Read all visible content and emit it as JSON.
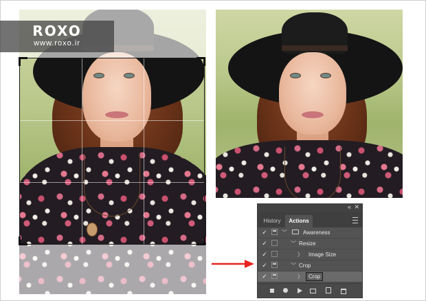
{
  "watermark": {
    "logo": "ROXO",
    "url": "www.roxo.ir"
  },
  "colors": {
    "arrow": "#e8231f",
    "panel_bg": "#535353",
    "panel_tab_bar": "#3f3f3f",
    "selected_row": "#6a6a6a"
  },
  "left_image": {
    "description_role": "photo-with-crop-overlay"
  },
  "right_image": {
    "description_role": "cropped-photo-result"
  },
  "actions_panel": {
    "top_controls": {
      "collapse": "«",
      "close": "✕"
    },
    "tabs": [
      {
        "label": "History",
        "active": false
      },
      {
        "label": "Actions",
        "active": true
      }
    ],
    "rows": [
      {
        "check": "✓",
        "dialog": true,
        "twisty": "﹀",
        "label": "Awareness",
        "kind": "set",
        "selected": false
      },
      {
        "check": "✓",
        "dialog": false,
        "twisty": "﹀",
        "label": "Resize",
        "kind": "action",
        "selected": false
      },
      {
        "check": "✓",
        "dialog": false,
        "twisty": "〉",
        "label": "Image Size",
        "kind": "step",
        "selected": false
      },
      {
        "check": "✓",
        "dialog": true,
        "twisty": "﹀",
        "label": "Crop",
        "kind": "action",
        "selected": false
      },
      {
        "check": "✓",
        "dialog": true,
        "twisty": "〉",
        "label": "Crop",
        "kind": "step",
        "selected": true
      }
    ],
    "bottom_icons": [
      "stop-icon",
      "record-icon",
      "play-icon",
      "new-set-icon",
      "new-action-icon",
      "trash-icon"
    ]
  }
}
